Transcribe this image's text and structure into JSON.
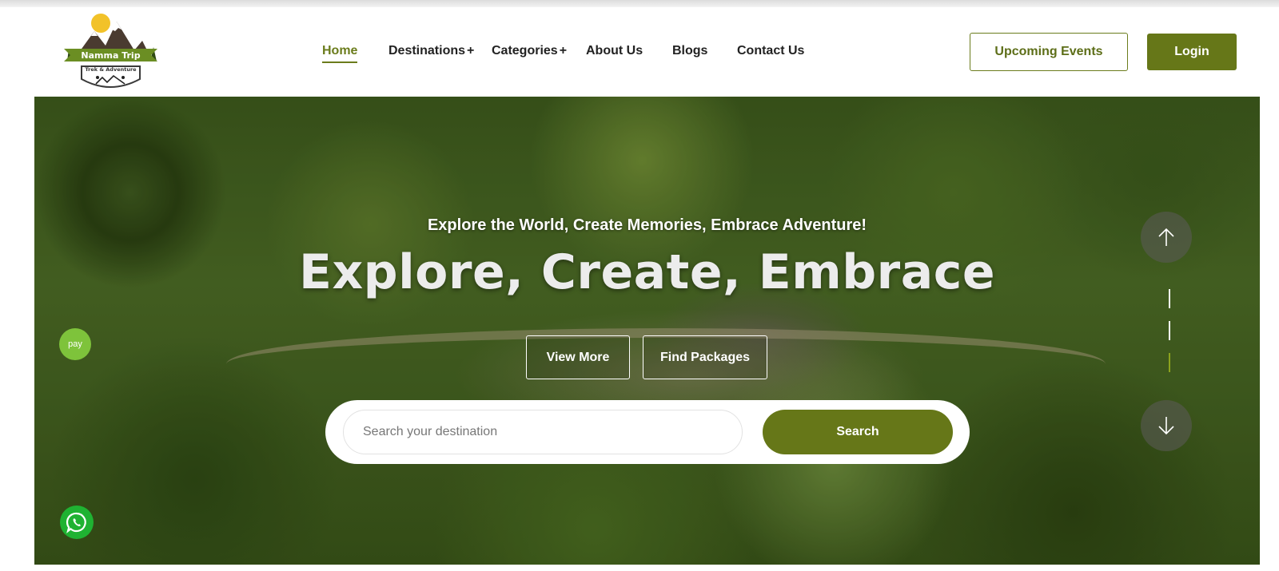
{
  "brand": {
    "name": "Namma Trip",
    "tagline": "Trek & Adventure"
  },
  "nav": {
    "items": [
      {
        "label": "Home",
        "active": true,
        "has_submenu": false
      },
      {
        "label": "Destinations",
        "active": false,
        "has_submenu": true
      },
      {
        "label": "Categories",
        "active": false,
        "has_submenu": true
      },
      {
        "label": "About Us",
        "active": false,
        "has_submenu": false
      },
      {
        "label": "Blogs",
        "active": false,
        "has_submenu": false
      },
      {
        "label": "Contact Us",
        "active": false,
        "has_submenu": false
      }
    ],
    "submenu_symbol": "+"
  },
  "header": {
    "events_label": "Upcoming Events",
    "login_label": "Login"
  },
  "hero": {
    "subtitle": "Explore the World, Create Memories, Embrace Adventure!",
    "title": "Explore, Create, Embrace",
    "view_more_label": "View More",
    "find_packages_label": "Find Packages",
    "search_placeholder": "Search your destination",
    "search_value": "",
    "search_label": "Search",
    "slide_count": 3,
    "active_slide": 3
  },
  "floating": {
    "pay_label": "pay",
    "whatsapp_icon": "whatsapp-icon"
  },
  "colors": {
    "accent": "#667718",
    "accent_text": "#6b7c1c",
    "slide_indicator_active": "#8ca21e",
    "pay_badge": "#7ec33b",
    "whatsapp": "#1fb232"
  }
}
